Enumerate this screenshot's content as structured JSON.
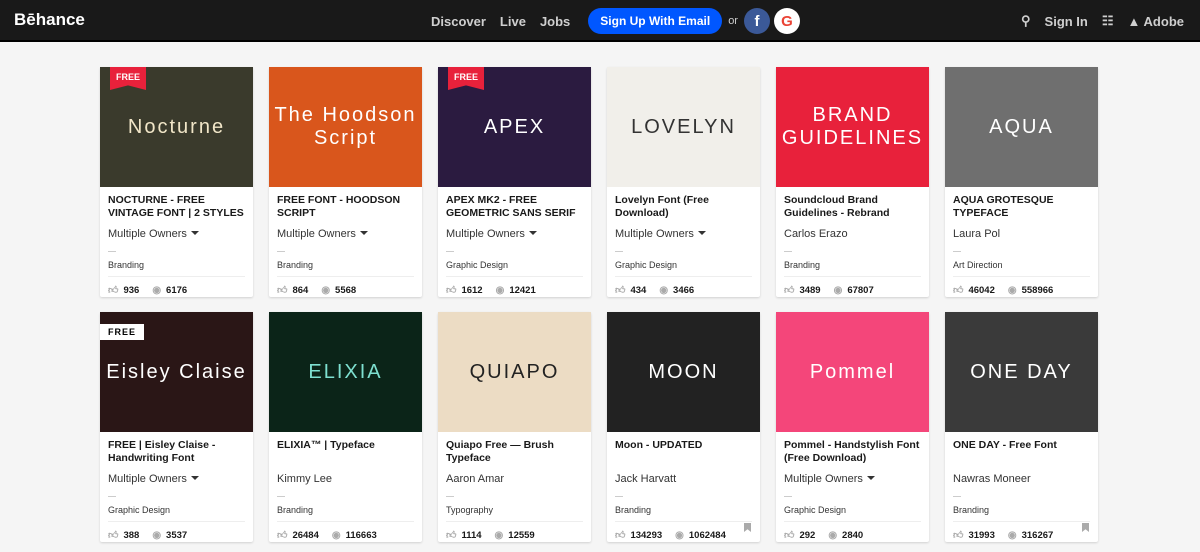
{
  "nav": {
    "logo": "Bēhance",
    "links": [
      "Discover",
      "Live",
      "Jobs"
    ],
    "signup": "Sign Up With Email",
    "or": "or",
    "facebook": "f",
    "google": "G",
    "signin": "Sign In",
    "adobe": "Adobe"
  },
  "cards": [
    {
      "title": "NOCTURNE - FREE VINTAGE FONT | 2 STYLES",
      "owner": "Multiple Owners",
      "multi": true,
      "field": "Branding",
      "likes": "936",
      "views": "6176",
      "badge": "FREE",
      "thumb": "Nocturne",
      "bg": "#3a3a2c",
      "fg": "#f1e6c8"
    },
    {
      "title": "FREE FONT - HOODSON SCRIPT",
      "owner": "Multiple Owners",
      "multi": true,
      "field": "Branding",
      "likes": "864",
      "views": "5568",
      "thumb": "The Hoodson Script",
      "bg": "#d9561c",
      "fg": "#ffffff"
    },
    {
      "title": "APEX MK2 - FREE GEOMETRIC SANS SERIF",
      "owner": "Multiple Owners",
      "multi": true,
      "field": "Graphic Design",
      "likes": "1612",
      "views": "12421",
      "badge": "FREE",
      "thumb": "APEX",
      "bg": "#2b1b40",
      "fg": "#ffffff"
    },
    {
      "title": "Lovelyn Font (Free Download)",
      "owner": "Multiple Owners",
      "multi": true,
      "field": "Graphic Design",
      "likes": "434",
      "views": "3466",
      "thumb": "LOVELYN",
      "bg": "#f1efea",
      "fg": "#333333"
    },
    {
      "title": "Soundcloud Brand Guidelines - Rebrand",
      "owner": "Carlos Erazo",
      "multi": false,
      "field": "Branding",
      "likes": "3489",
      "views": "67807",
      "thumb": "BRAND GUIDELINES",
      "bg": "#e8213b",
      "fg": "#ffffff"
    },
    {
      "title": "AQUA GROTESQUE TYPEFACE",
      "owner": "Laura Pol",
      "multi": false,
      "field": "Art Direction",
      "likes": "46042",
      "views": "558966",
      "thumb": "AQUA",
      "bg": "#6f6f6f",
      "fg": "#ffffff"
    },
    {
      "title": "FREE | Eisley Claise - Handwriting Font",
      "owner": "Multiple Owners",
      "multi": true,
      "field": "Graphic Design",
      "likes": "388",
      "views": "3537",
      "badge2": "FREE",
      "thumb": "Eisley Claise",
      "bg": "#2a1616",
      "fg": "#ffffff"
    },
    {
      "title": "ELIXIA™ | Typeface",
      "owner": "Kimmy Lee",
      "multi": false,
      "field": "Branding",
      "likes": "26484",
      "views": "116663",
      "thumb": "ELIXIA",
      "bg": "#0b2418",
      "fg": "#7ee0d0"
    },
    {
      "title": "Quiapo Free — Brush Typeface",
      "owner": "Aaron Amar",
      "multi": false,
      "field": "Typography",
      "likes": "1114",
      "views": "12559",
      "thumb": "QUIAPO",
      "bg": "#ecdcc4",
      "fg": "#222222"
    },
    {
      "title": "Moon - UPDATED",
      "owner": "Jack Harvatt",
      "multi": false,
      "field": "Branding",
      "likes": "134293",
      "views": "1062484",
      "bookmark": true,
      "thumb": "MOON",
      "bg": "#222222",
      "fg": "#ffffff"
    },
    {
      "title": "Pommel - Handstylish Font (Free Download)",
      "owner": "Multiple Owners",
      "multi": true,
      "field": "Graphic Design",
      "likes": "292",
      "views": "2840",
      "thumb": "Pommel",
      "bg": "#f4467a",
      "fg": "#ffffff"
    },
    {
      "title": "ONE DAY - Free Font",
      "owner": "Nawras Moneer",
      "multi": false,
      "field": "Branding",
      "likes": "31993",
      "views": "316267",
      "bookmark": true,
      "thumb": "ONE DAY",
      "bg": "#3a3a3a",
      "fg": "#ffffff"
    }
  ]
}
